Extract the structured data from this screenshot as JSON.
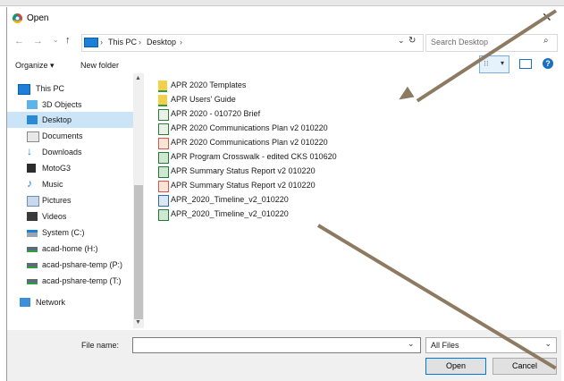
{
  "window": {
    "title": "Open"
  },
  "address": {
    "crumbs": [
      "This PC",
      "Desktop"
    ],
    "sep": "›"
  },
  "search": {
    "placeholder": "Search Desktop"
  },
  "toolbar": {
    "organize": "Organize ▾",
    "new_folder": "New folder"
  },
  "sidebar": {
    "items": [
      {
        "label": "This PC",
        "icon": "this-pc-icon"
      },
      {
        "label": "3D Objects",
        "icon": "3d-objects-icon"
      },
      {
        "label": "Desktop",
        "icon": "desktop-folder-icon"
      },
      {
        "label": "Documents",
        "icon": "documents-icon"
      },
      {
        "label": "Downloads",
        "icon": "downloads-icon"
      },
      {
        "label": "MotoG3",
        "icon": "phone-icon"
      },
      {
        "label": "Music",
        "icon": "music-icon"
      },
      {
        "label": "Pictures",
        "icon": "pictures-icon"
      },
      {
        "label": "Videos",
        "icon": "videos-icon"
      },
      {
        "label": "System (C:)",
        "icon": "drive-icon"
      },
      {
        "label": "acad-home (H:)",
        "icon": "network-drive-icon"
      },
      {
        "label": "acad-pshare-temp (P:)",
        "icon": "network-drive-icon"
      },
      {
        "label": "acad-pshare-temp (T:)",
        "icon": "network-drive-icon"
      },
      {
        "label": "Network",
        "icon": "network-icon"
      }
    ]
  },
  "files": [
    {
      "name": "APR 2020 Templates",
      "icon": "shortcut-folder-icon"
    },
    {
      "name": "APR Users' Guide",
      "icon": "shortcut-folder-icon"
    },
    {
      "name": "APR 2020 - 010720 Brief",
      "icon": "file-icon"
    },
    {
      "name": "APR 2020 Communications Plan v2 010220",
      "icon": "file-icon"
    },
    {
      "name": "APR 2020 Communications Plan v2 010220",
      "icon": "pdf-icon"
    },
    {
      "name": "APR Program Crosswalk - edited CKS 010620",
      "icon": "excel-icon"
    },
    {
      "name": "APR Summary Status Report v2 010220",
      "icon": "excel-icon"
    },
    {
      "name": "APR Summary Status Report v2 010220",
      "icon": "pdf-icon"
    },
    {
      "name": "APR_2020_Timeline_v2_010220",
      "icon": "project-icon"
    },
    {
      "name": "APR_2020_Timeline_v2_010220",
      "icon": "excel-icon"
    }
  ],
  "footer": {
    "file_name_label": "File name:",
    "file_name_value": "",
    "filter": "All Files",
    "open": "Open",
    "cancel": "Cancel"
  },
  "colors": {
    "accent": "#0078d7",
    "selected": "#cce4f7",
    "arrow": "#8c7a61"
  }
}
